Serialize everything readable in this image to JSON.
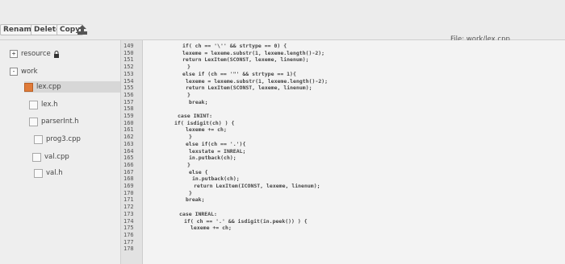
{
  "toolbar": {
    "rename_label": "Rename",
    "delete_label": "Delete",
    "copy_label": "Copy",
    "upload_icon": "upload-icon",
    "file_label": "File: work/lex.cpp"
  },
  "tree": {
    "resource": {
      "label": "resource",
      "expander": "+",
      "icon": "lock-icon"
    },
    "work": {
      "label": "work",
      "expander": "-"
    },
    "files": [
      {
        "label": "lex.cpp",
        "active": true
      },
      {
        "label": "lex.h",
        "active": false
      },
      {
        "label": "parserInt.h",
        "active": false
      },
      {
        "label": "prog3.cpp",
        "active": false
      },
      {
        "label": "val.cpp",
        "active": false
      },
      {
        "label": "val.h",
        "active": false
      }
    ]
  },
  "editor": {
    "line_numbers": [
      "149",
      "150",
      "151",
      "152",
      "153",
      "154",
      "155",
      "156",
      "157",
      "158",
      "159",
      "160",
      "161",
      "162",
      "163",
      "164",
      "165",
      "166",
      "167",
      "168",
      "169",
      "170",
      "171",
      "172",
      "173",
      "174",
      "175",
      "176",
      "177",
      "178"
    ],
    "lines": [
      "if( ch == '\\'' && strtype == 0) {",
      "    lexeme = lexeme.substr(1, lexeme.length()-2);",
      "    return LexItem(SCONST, lexeme, linenum);",
      "}",
      "else if (ch == '\"' && strtype == 1){",
      "    lexeme = lexeme.substr(1, lexeme.length()-2);",
      "    return LexItem(SCONST, lexeme, linenum);",
      "}",
      "break;",
      "",
      "case ININT:",
      "  if( isdigit(ch) ) {",
      "      lexeme += ch;",
      "  }",
      "  else if(ch == '.'){",
      "      lexstate = INREAL;",
      "      in.putback(ch);",
      "  }",
      "  else {",
      "      in.putback(ch);",
      "      return LexItem(ICONST, lexeme, linenum);",
      "  }",
      "  break;",
      "",
      "case INREAL:",
      "  if( ch == '.' && isdigit(in.peek()) ) {",
      "      lexeme += ch;",
      "",
      "",
      ""
    ]
  }
}
